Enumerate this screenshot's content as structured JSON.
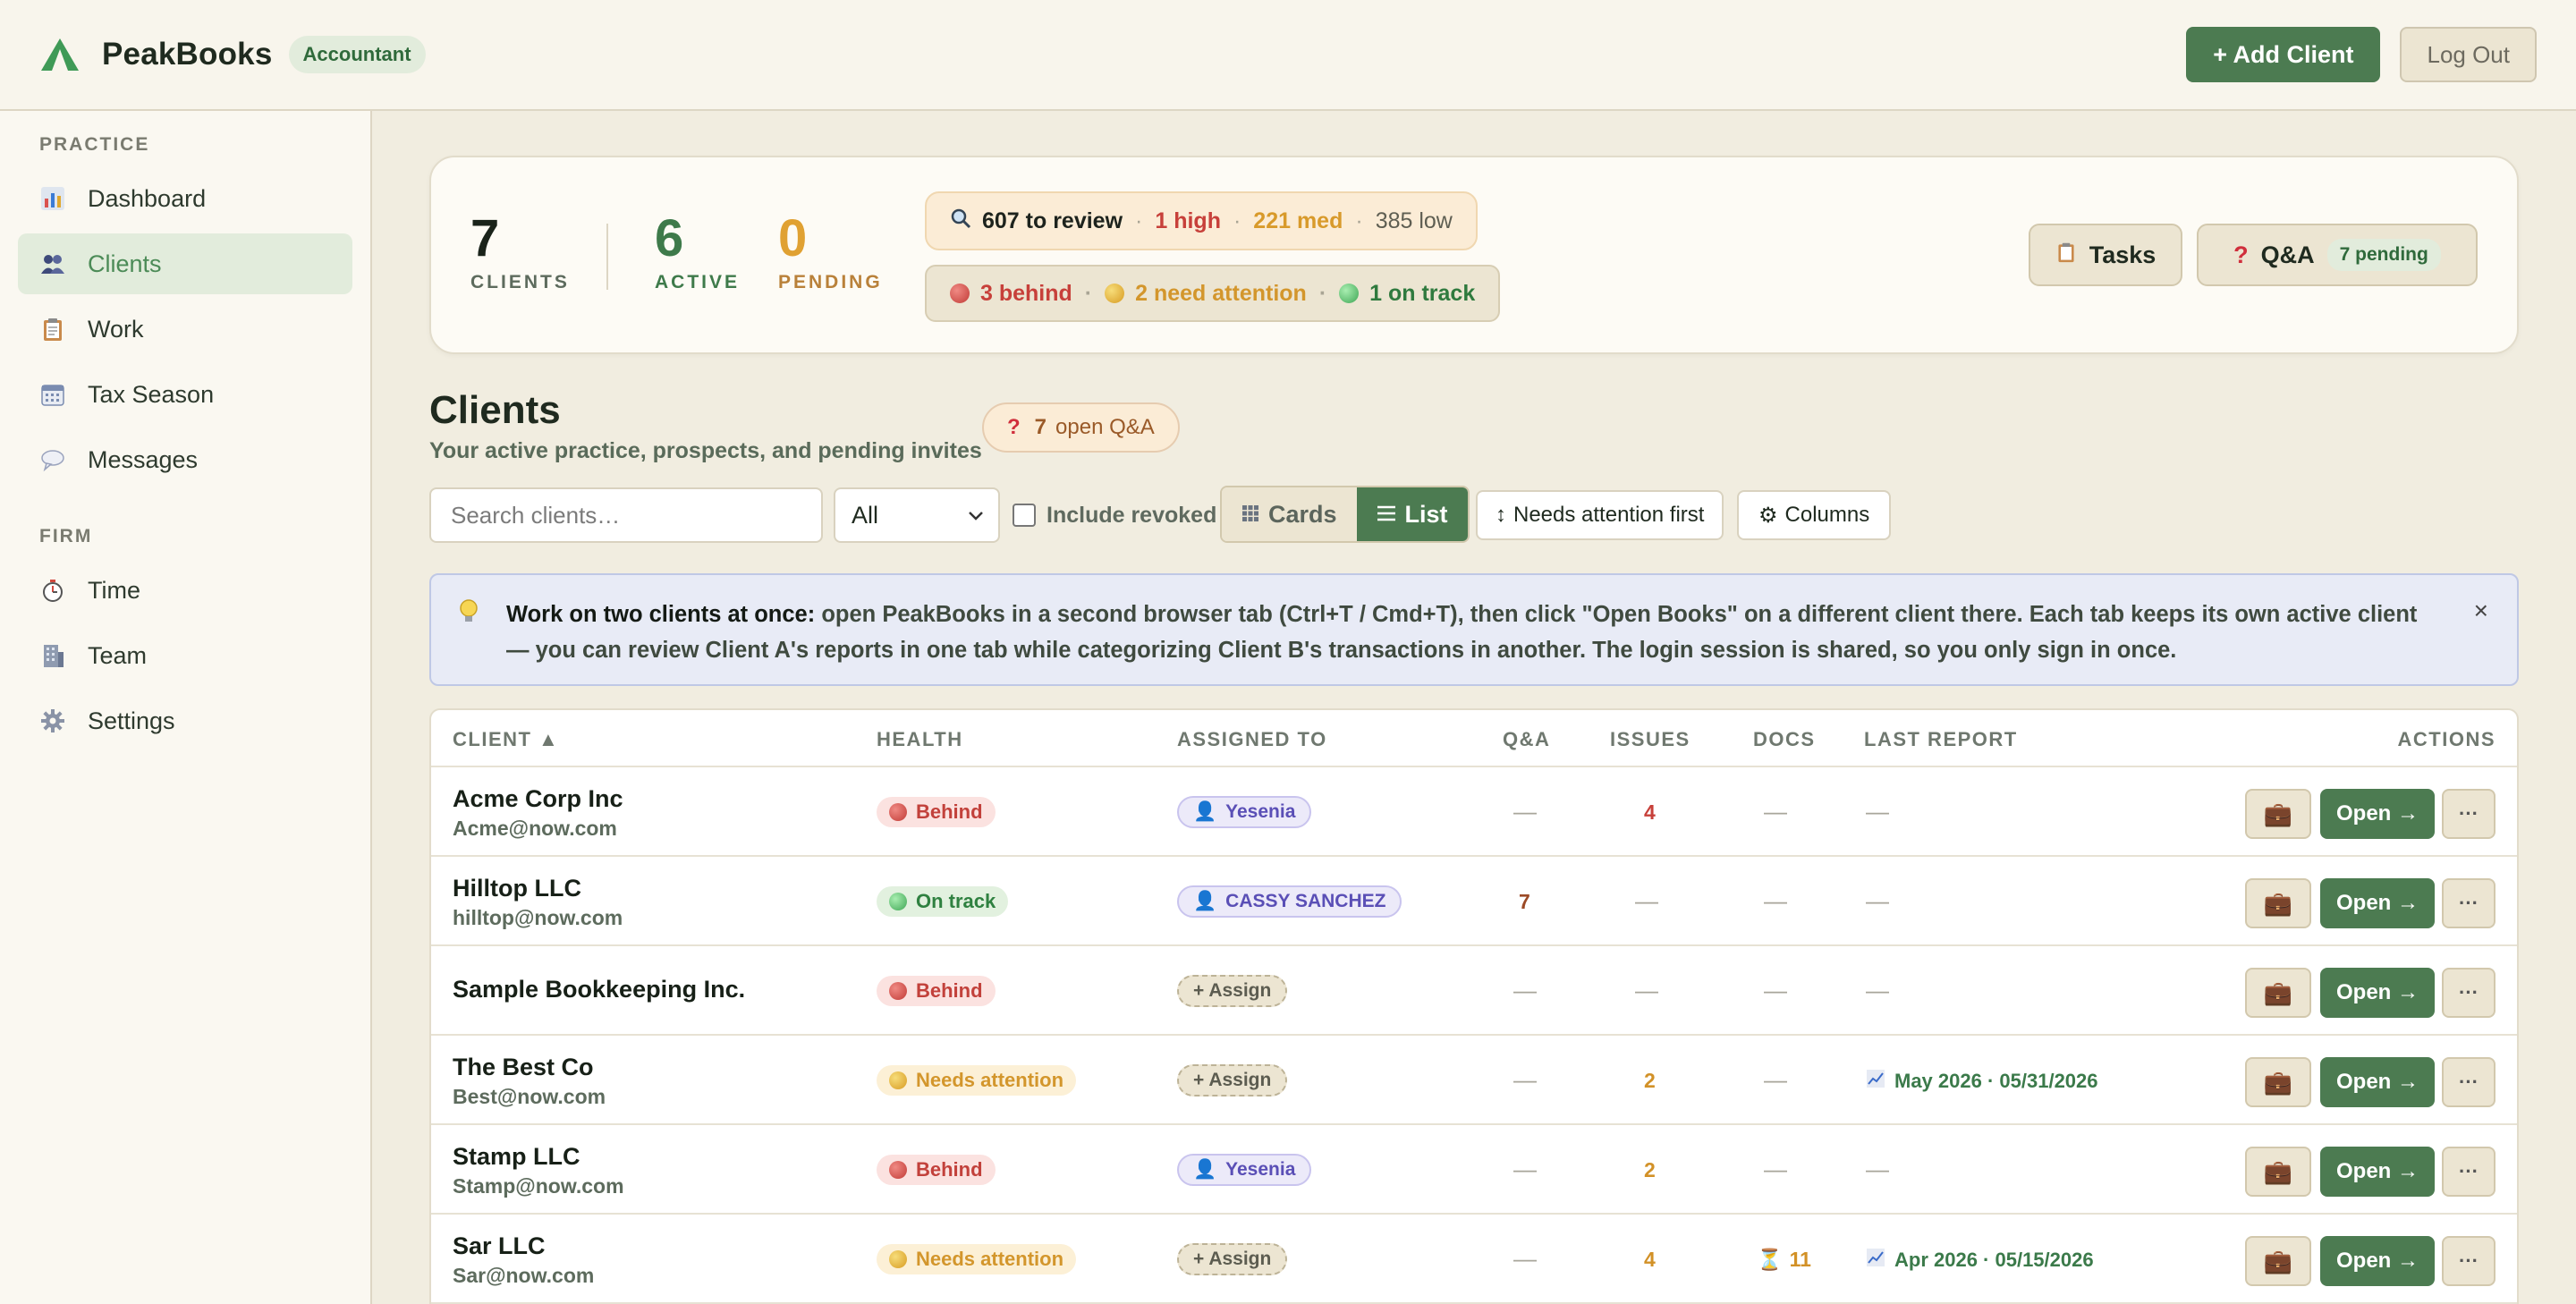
{
  "header": {
    "brand": "PeakBooks",
    "role_badge": "Accountant",
    "add_client_label": "+ Add Client",
    "logout_label": "Log Out",
    "accent_color": "#4c7b51"
  },
  "sidebar": {
    "practice_title": "PRACTICE",
    "firm_title": "FIRM",
    "practice_items": [
      {
        "label": "Dashboard",
        "icon": "bar-chart-icon"
      },
      {
        "label": "Clients",
        "icon": "people-icon",
        "active": true
      },
      {
        "label": "Work",
        "icon": "clipboard-icon"
      },
      {
        "label": "Tax Season",
        "icon": "calendar-icon"
      },
      {
        "label": "Messages",
        "icon": "speech-bubble-icon"
      }
    ],
    "firm_items": [
      {
        "label": "Time",
        "icon": "stopwatch-icon"
      },
      {
        "label": "Team",
        "icon": "office-building-icon"
      },
      {
        "label": "Settings",
        "icon": "gear-icon"
      }
    ]
  },
  "summary": {
    "clients_count": "7",
    "clients_label": "CLIENTS",
    "active_count": "6",
    "active_label": "ACTIVE",
    "pending_count": "0",
    "pending_label": "PENDING",
    "review_text": "607 to review",
    "review_high": "1 high",
    "review_med": "221 med",
    "review_low": "385 low",
    "behind_text": "3 behind",
    "attention_text": "2 need attention",
    "ontrack_text": "1 on track",
    "tasks_label": "Tasks",
    "qa_label": "Q&A",
    "qa_pending": "7 pending"
  },
  "page": {
    "title": "Clients",
    "subtitle": "Your active practice, prospects, and pending invites",
    "open_qa_count": "7",
    "open_qa_label": "open Q&A"
  },
  "toolbar": {
    "search_placeholder": "Search clients…",
    "filter_value": "All",
    "include_revoked_label": "Include revoked",
    "cards_label": "Cards",
    "list_label": "List",
    "sort_label": "Needs attention first",
    "columns_label": "Columns"
  },
  "tip": {
    "bold": "Work on two clients at once:",
    "text": " open PeakBooks in a second browser tab (Ctrl+T / Cmd+T), then click \"Open Books\" on a different client there. Each tab keeps its own active client — you can review Client A's reports in one tab while categorizing Client B's transactions in another. The login session is shared, so you only sign in once.",
    "close": "×"
  },
  "table": {
    "columns": {
      "client": "CLIENT ▲",
      "health": "HEALTH",
      "assigned": "ASSIGNED TO",
      "qa": "Q&A",
      "issues": "ISSUES",
      "docs": "DOCS",
      "last_report": "LAST REPORT",
      "actions": "ACTIONS"
    },
    "open_label": "Open →",
    "more_label": "···",
    "dash": "—",
    "rows": [
      {
        "name": "Acme Corp Inc",
        "email": "Acme@now.com",
        "health": "Behind",
        "assigned": "Yesenia",
        "qa": "—",
        "issues": "4",
        "docs": "—",
        "report": "—"
      },
      {
        "name": "Hilltop LLC",
        "email": "hilltop@now.com",
        "health": "On track",
        "assigned": "CASSY SANCHEZ",
        "qa": "7",
        "issues": "—",
        "docs": "—",
        "report": "—"
      },
      {
        "name": "Sample Bookkeeping Inc.",
        "email": "",
        "health": "Behind",
        "assigned": "+ Assign",
        "qa": "—",
        "issues": "—",
        "docs": "—",
        "report": "—"
      },
      {
        "name": "The Best Co",
        "email": "Best@now.com",
        "health": "Needs attention",
        "assigned": "+ Assign",
        "qa": "—",
        "issues": "2",
        "docs": "—",
        "report": "May 2026 · 05/31/2026"
      },
      {
        "name": "Stamp LLC",
        "email": "Stamp@now.com",
        "health": "Behind",
        "assigned": "Yesenia",
        "qa": "—",
        "issues": "2",
        "docs": "—",
        "report": "—"
      },
      {
        "name": "Sar LLC",
        "email": "Sar@now.com",
        "health": "Needs attention",
        "assigned": "+ Assign",
        "qa": "—",
        "issues": "4",
        "docs": "11",
        "report": "Apr 2026 · 05/15/2026"
      }
    ]
  }
}
